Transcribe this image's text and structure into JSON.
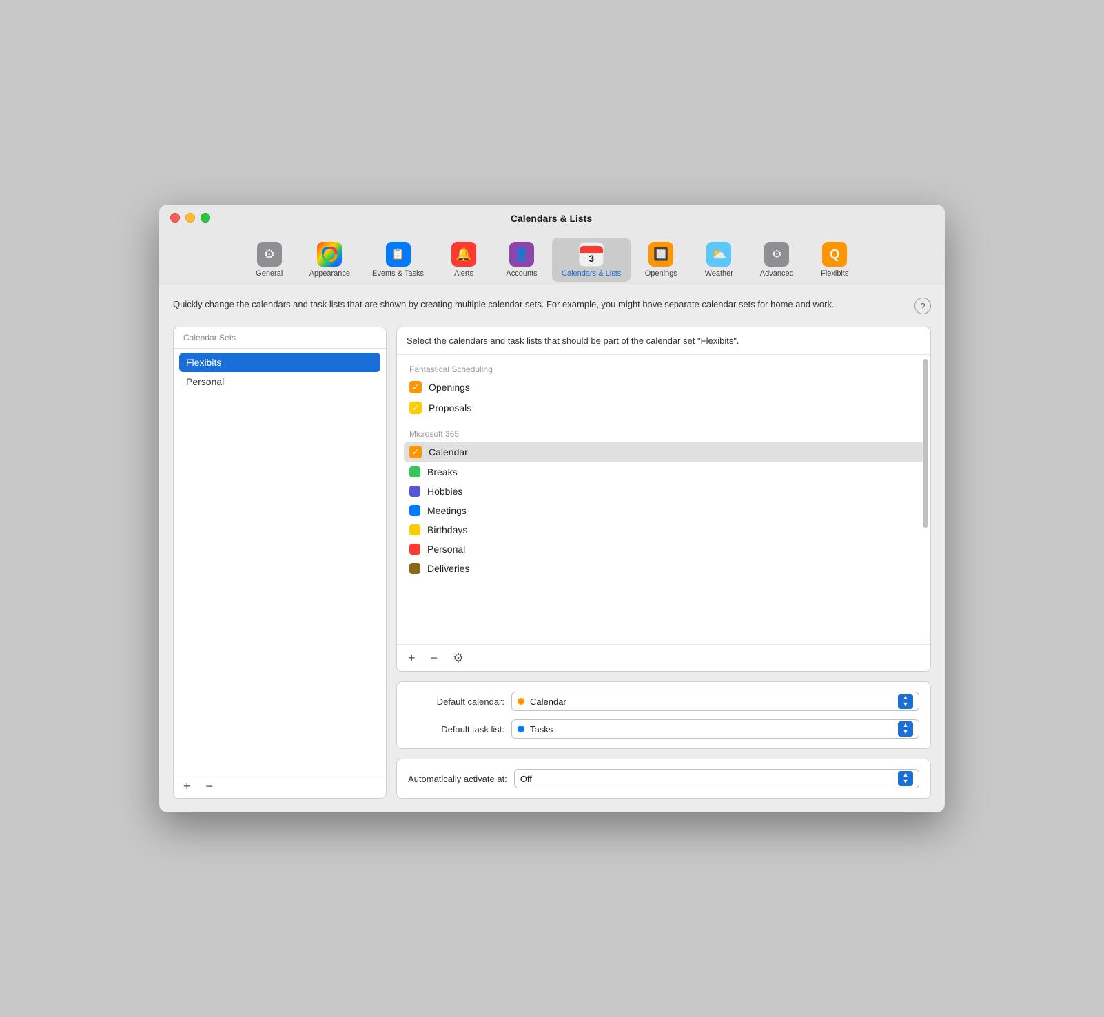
{
  "window": {
    "title": "Calendars & Lists"
  },
  "toolbar": {
    "items": [
      {
        "id": "general",
        "label": "General",
        "icon": "⚙"
      },
      {
        "id": "appearance",
        "label": "Appearance",
        "icon": "🎨"
      },
      {
        "id": "events",
        "label": "Events & Tasks",
        "icon": "📋"
      },
      {
        "id": "alerts",
        "label": "Alerts",
        "icon": "🔔"
      },
      {
        "id": "accounts",
        "label": "Accounts",
        "icon": "👤"
      },
      {
        "id": "calendars",
        "label": "Calendars & Lists",
        "icon": "3",
        "active": true
      },
      {
        "id": "openings",
        "label": "Openings",
        "icon": "🔲"
      },
      {
        "id": "weather",
        "label": "Weather",
        "icon": "⛅"
      },
      {
        "id": "advanced",
        "label": "Advanced",
        "icon": "⚙"
      },
      {
        "id": "flexibits",
        "label": "Flexibits",
        "icon": "Q"
      }
    ]
  },
  "description": {
    "text": "Quickly change the calendars and task lists that are shown by creating multiple calendar sets. For example, you might have separate calendar sets for home and work.",
    "help_label": "?"
  },
  "left_panel": {
    "header": "Calendar Sets",
    "items": [
      {
        "label": "Flexibits",
        "selected": true
      },
      {
        "label": "Personal",
        "selected": false
      }
    ],
    "add_btn": "+",
    "remove_btn": "−"
  },
  "right_panel": {
    "selector": {
      "instruction": "Select the calendars and task lists that should be part of the calendar set \"Flexibits\".",
      "groups": [
        {
          "label": "Fantastical Scheduling",
          "items": [
            {
              "label": "Openings",
              "color": "#ff9500",
              "checked": true,
              "highlighted": false
            },
            {
              "label": "Proposals",
              "color": "#ffcc00",
              "checked": true,
              "highlighted": false
            }
          ]
        },
        {
          "label": "Microsoft 365",
          "items": [
            {
              "label": "Calendar",
              "color": "#ff9500",
              "checked": true,
              "highlighted": true
            },
            {
              "label": "Breaks",
              "color": "#34c759",
              "checked": false,
              "highlighted": false
            },
            {
              "label": "Hobbies",
              "color": "#5856d6",
              "checked": false,
              "highlighted": false
            },
            {
              "label": "Meetings",
              "color": "#007aff",
              "checked": false,
              "highlighted": false
            },
            {
              "label": "Birthdays",
              "color": "#ffcc00",
              "checked": false,
              "highlighted": false
            },
            {
              "label": "Personal",
              "color": "#ff3b30",
              "checked": false,
              "highlighted": false
            },
            {
              "label": "Deliveries",
              "color": "#8b6914",
              "checked": false,
              "highlighted": false
            }
          ]
        }
      ],
      "add_btn": "+",
      "remove_btn": "−",
      "settings_btn": "⚙"
    },
    "defaults": {
      "default_calendar_label": "Default calendar:",
      "default_calendar_value": "Calendar",
      "default_calendar_color": "#ff9500",
      "default_task_label": "Default task list:",
      "default_task_value": "Tasks",
      "default_task_color": "#007aff"
    },
    "activate": {
      "label": "Automatically activate at:",
      "value": "Off"
    }
  }
}
